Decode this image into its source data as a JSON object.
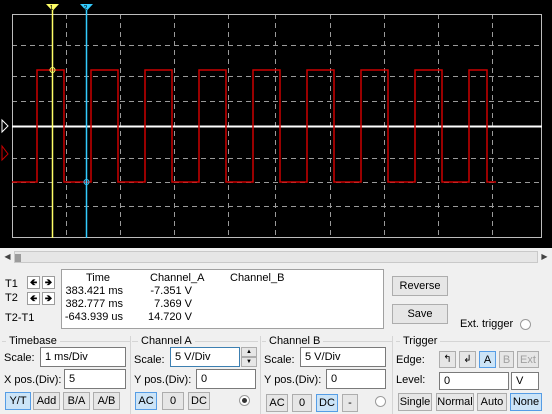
{
  "cursors": {
    "t1": {
      "label": "T1"
    },
    "t2": {
      "label": "T2"
    },
    "t2t1": {
      "label": "T2-T1"
    }
  },
  "readout": {
    "headers": [
      "Time",
      "Channel_A",
      "Channel_B"
    ],
    "rows": [
      {
        "time": "383.421 ms",
        "channel_a": "-7.351 V",
        "channel_b": ""
      },
      {
        "time": "382.777 ms",
        "channel_a": "7.369 V",
        "channel_b": ""
      },
      {
        "time": "-643.939 us",
        "channel_a": "14.720 V",
        "channel_b": ""
      }
    ]
  },
  "side_buttons": {
    "reverse": "Reverse",
    "save": "Save",
    "ext_trigger": "Ext. trigger"
  },
  "timebase": {
    "title": "Timebase",
    "scale_label": "Scale:",
    "scale_value": "1 ms/Div",
    "xpos_label": "X pos.(Div):",
    "xpos_value": "5",
    "buttons": [
      "Y/T",
      "Add",
      "B/A",
      "A/B"
    ]
  },
  "channel_a": {
    "title": "Channel A",
    "scale_label": "Scale:",
    "scale_value": "5  V/Div",
    "ypos_label": "Y pos.(Div):",
    "ypos_value": "0",
    "coupling": [
      "AC",
      "0",
      "DC"
    ]
  },
  "channel_b": {
    "title": "Channel B",
    "scale_label": "Scale:",
    "scale_value": "5  V/Div",
    "ypos_label": "Y pos.(Div):",
    "ypos_value": "0",
    "coupling": [
      "AC",
      "0",
      "DC",
      "-"
    ]
  },
  "trigger": {
    "title": "Trigger",
    "edge_label": "Edge:",
    "edge_sources": [
      "A",
      "B",
      "Ext"
    ],
    "level_label": "Level:",
    "level_value": "0",
    "level_unit": "V",
    "modes": [
      "Single",
      "Normal",
      "Auto",
      "None"
    ]
  },
  "colors": {
    "trace_a": "#cc0000",
    "cursor_t1": "#ffff66",
    "cursor_t2": "#33ccff",
    "trace_b": "#ffffff",
    "screen_bg": "#000000"
  }
}
